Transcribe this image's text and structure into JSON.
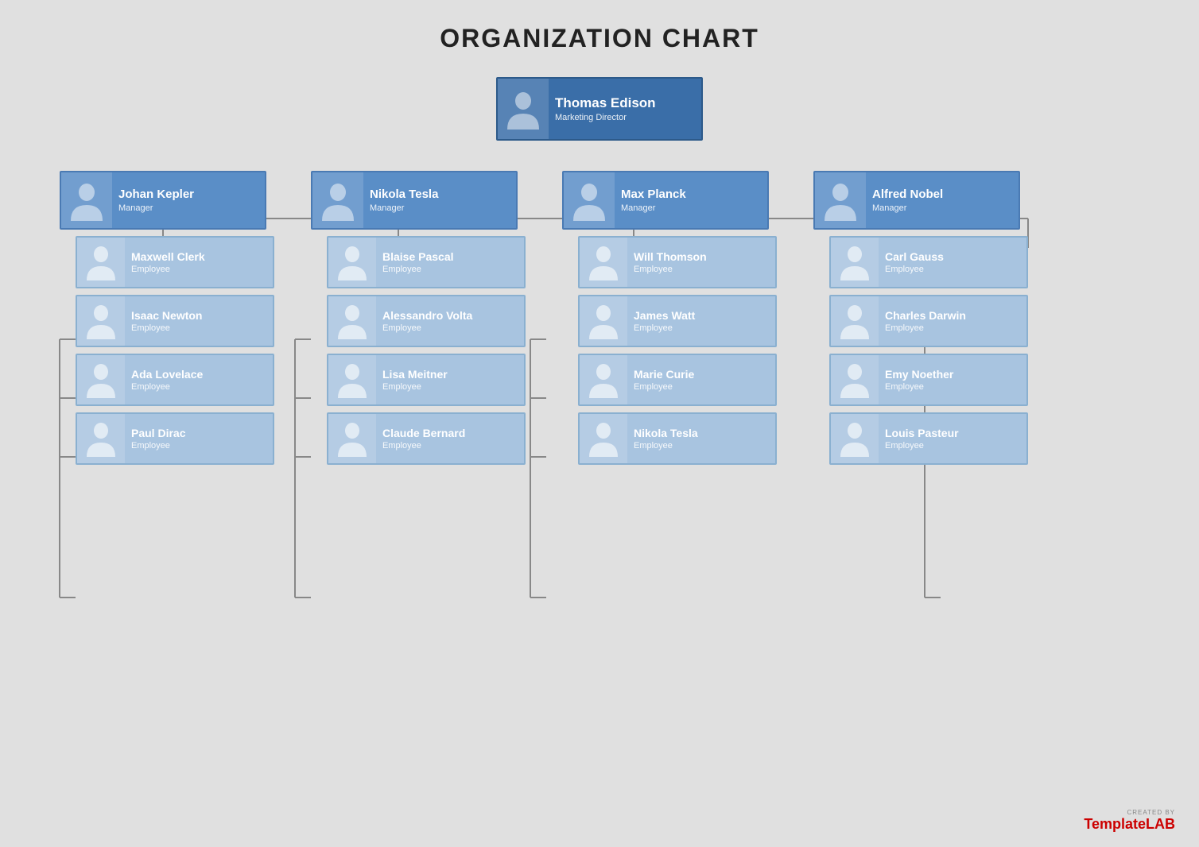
{
  "title": "ORGANIZATION CHART",
  "colors": {
    "director_bg": "#3a6ea8",
    "manager_bg": "#5a8ec7",
    "employee_bg": "#a8c4e0",
    "line": "#888888",
    "accent_red": "#cc0000"
  },
  "director": {
    "name": "Thomas Edison",
    "role": "Marketing Director"
  },
  "managers": [
    {
      "name": "Johan Kepler",
      "role": "Manager",
      "employees": [
        {
          "name": "Maxwell Clerk",
          "role": "Employee"
        },
        {
          "name": "Isaac Newton",
          "role": "Employee"
        },
        {
          "name": "Ada Lovelace",
          "role": "Employee"
        },
        {
          "name": "Paul Dirac",
          "role": "Employee"
        }
      ]
    },
    {
      "name": "Nikola Tesla",
      "role": "Manager",
      "employees": [
        {
          "name": "Blaise Pascal",
          "role": "Employee"
        },
        {
          "name": "Alessandro Volta",
          "role": "Employee"
        },
        {
          "name": "Lisa Meitner",
          "role": "Employee"
        },
        {
          "name": "Claude Bernard",
          "role": "Employee"
        }
      ]
    },
    {
      "name": "Max Planck",
      "role": "Manager",
      "employees": [
        {
          "name": "Will Thomson",
          "role": "Employee"
        },
        {
          "name": "James Watt",
          "role": "Employee"
        },
        {
          "name": "Marie Curie",
          "role": "Employee"
        },
        {
          "name": "Nikola Tesla",
          "role": "Employee"
        }
      ]
    },
    {
      "name": "Alfred Nobel",
      "role": "Manager",
      "employees": [
        {
          "name": "Carl Gauss",
          "role": "Employee"
        },
        {
          "name": "Charles Darwin",
          "role": "Employee"
        },
        {
          "name": "Emy Noether",
          "role": "Employee"
        },
        {
          "name": "Louis Pasteur",
          "role": "Employee"
        }
      ]
    }
  ],
  "watermark": {
    "created_by": "CREATED BY",
    "brand_normal": "Template",
    "brand_bold": "LAB"
  }
}
